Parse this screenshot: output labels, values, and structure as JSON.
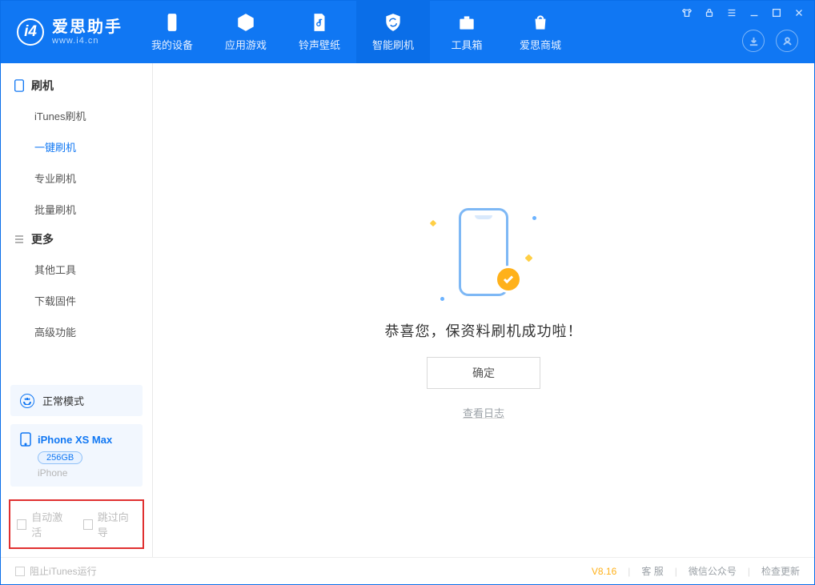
{
  "app": {
    "name_cn": "爱思助手",
    "name_en": "www.i4.cn"
  },
  "nav": {
    "device": "我的设备",
    "apps": "应用游戏",
    "ringtone": "铃声壁纸",
    "flash": "智能刷机",
    "toolbox": "工具箱",
    "store": "爱思商城"
  },
  "sidebar": {
    "group_flash": "刷机",
    "items_flash": [
      "iTunes刷机",
      "一键刷机",
      "专业刷机",
      "批量刷机"
    ],
    "active_flash_index": 1,
    "group_more": "更多",
    "items_more": [
      "其他工具",
      "下载固件",
      "高级功能"
    ]
  },
  "mode": {
    "label": "正常模式"
  },
  "device": {
    "name": "iPhone XS Max",
    "capacity": "256GB",
    "type": "iPhone"
  },
  "options": {
    "auto_activate": "自动激活",
    "skip_guide": "跳过向导"
  },
  "main": {
    "success": "恭喜您，保资料刷机成功啦！",
    "ok": "确定",
    "view_log": "查看日志"
  },
  "footer": {
    "block_itunes": "阻止iTunes运行",
    "version": "V8.16",
    "cs": "客 服",
    "wechat": "微信公众号",
    "update": "检查更新"
  }
}
